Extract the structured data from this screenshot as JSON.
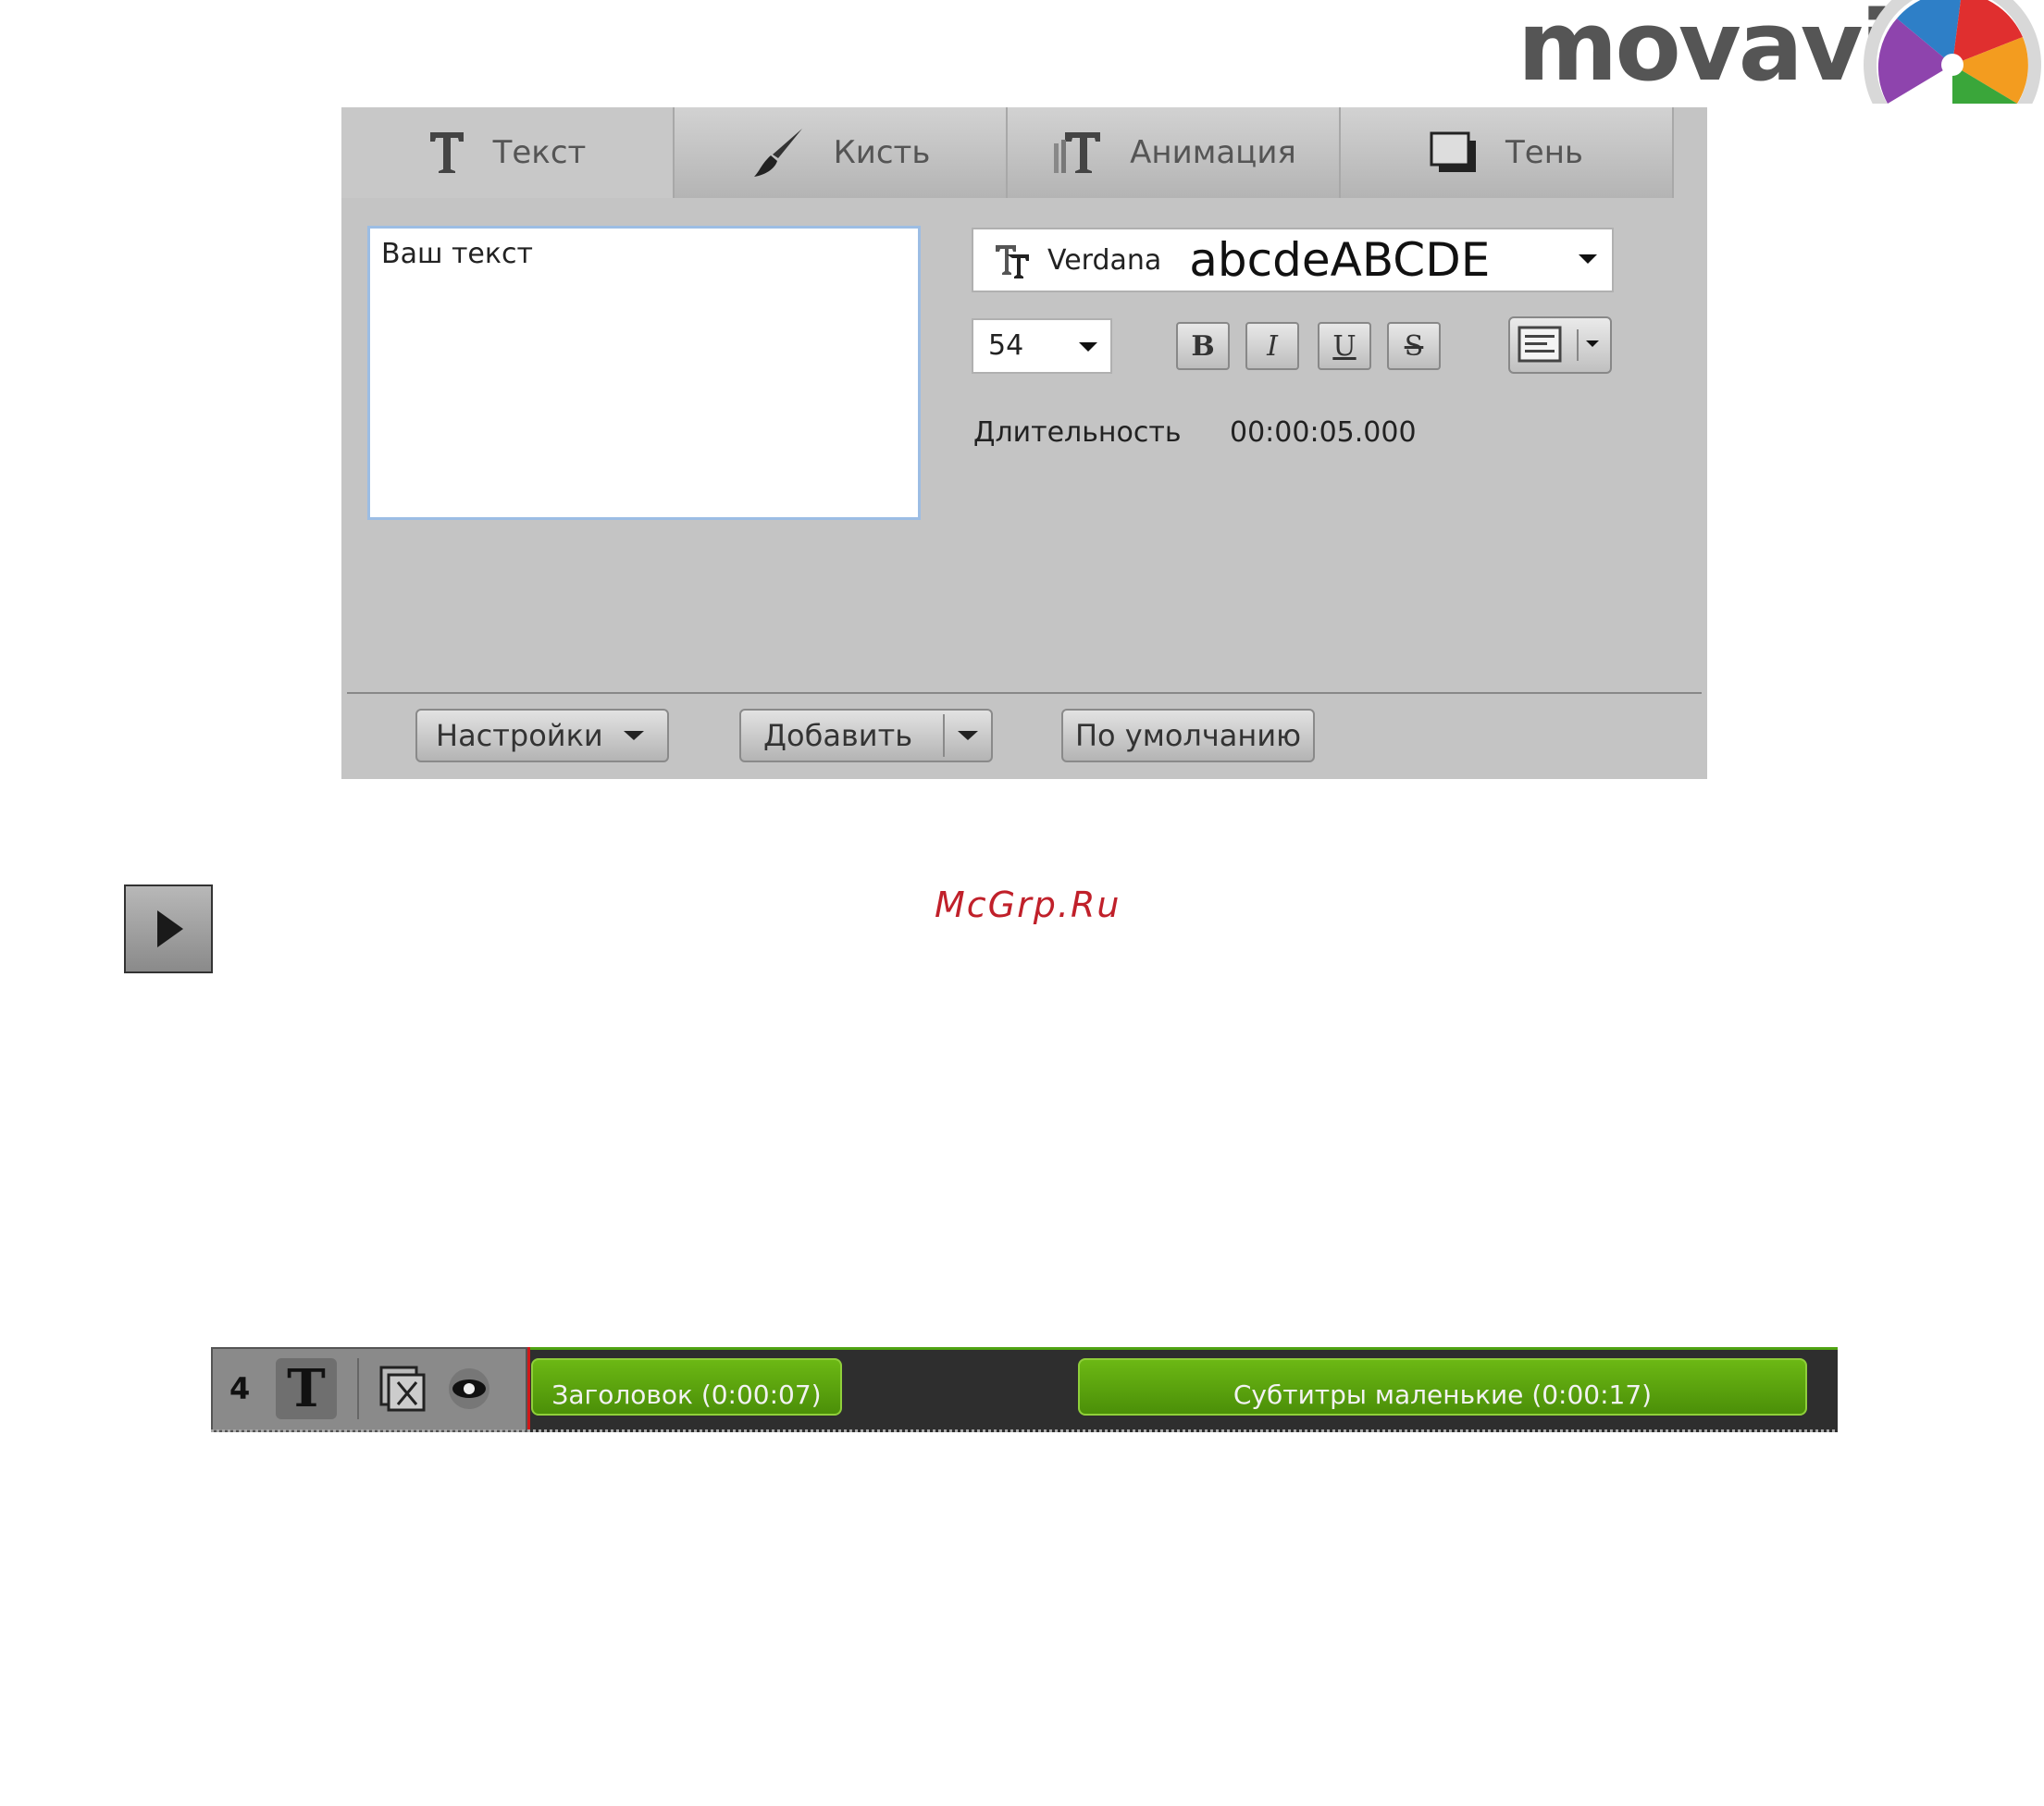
{
  "logo": {
    "brand_text": "movavi"
  },
  "editor": {
    "tabs": [
      {
        "label": "Текст",
        "icon": "text-T-icon",
        "active": true
      },
      {
        "label": "Кисть",
        "icon": "brush-icon",
        "active": false
      },
      {
        "label": "Анимация",
        "icon": "animation-icon",
        "active": false
      },
      {
        "label": "Тень",
        "icon": "shadow-icon",
        "active": false
      }
    ],
    "text_value": "Ваш текст",
    "font": {
      "name": "Verdana",
      "sample": "abcdeABCDE"
    },
    "size": "54",
    "format_buttons": [
      {
        "label": "B",
        "name": "bold-button"
      },
      {
        "label": "I",
        "name": "italic-button"
      },
      {
        "label": "U",
        "name": "underline-button"
      },
      {
        "label": "S",
        "name": "strikethrough-button"
      }
    ],
    "duration": {
      "label": "Длительность",
      "value": "00:00:05.000"
    },
    "buttons": {
      "settings": "Настройки",
      "add": "Добавить",
      "default": "По умолчанию"
    }
  },
  "watermark": "McGrp.Ru",
  "timeline": {
    "track_number": "4",
    "track_type_glyph": "T",
    "clips": [
      {
        "label": "Заголовок (0:00:07)"
      },
      {
        "label": "Субтитры маленькие (0:00:17)"
      }
    ]
  },
  "colors": {
    "panel_bg": "#c4c4c4",
    "clip_green": "#5ea810",
    "playhead": "#d01818",
    "watermark": "#c0202a"
  }
}
